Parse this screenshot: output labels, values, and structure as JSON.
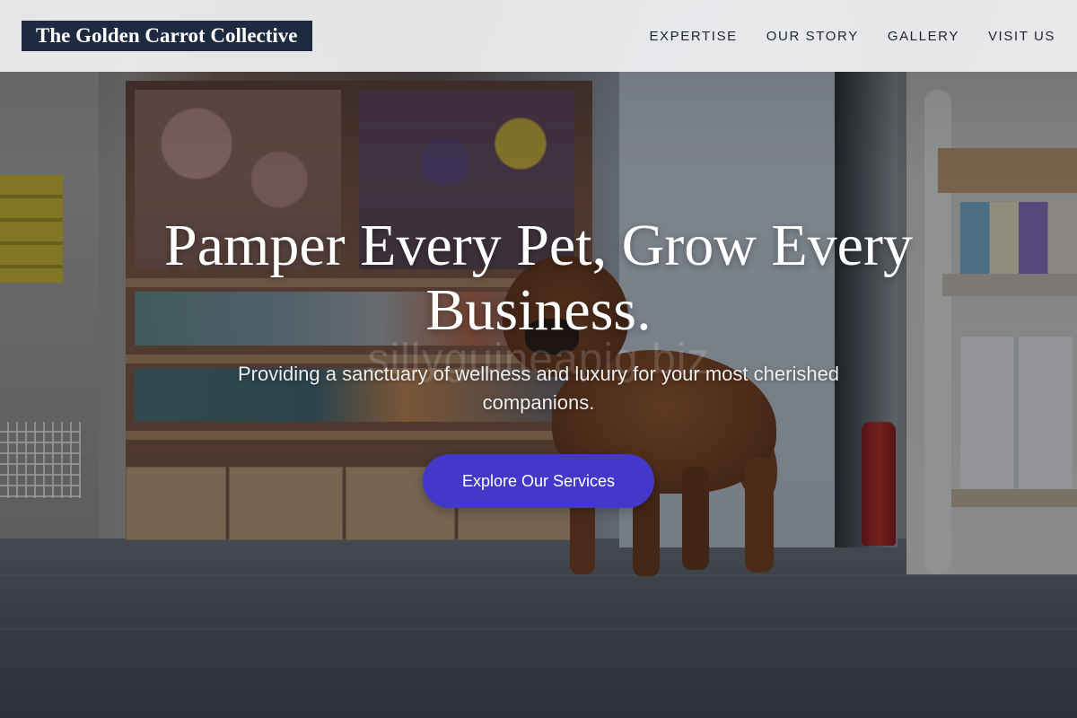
{
  "header": {
    "logo_text": "The Golden Carrot Collective",
    "nav": [
      {
        "label": "EXPERTISE"
      },
      {
        "label": "OUR STORY"
      },
      {
        "label": "GALLERY"
      },
      {
        "label": "VISIT US"
      }
    ]
  },
  "hero": {
    "headline": "Pamper Every Pet, Grow Every Business.",
    "subtitle": "Providing a sanctuary of wellness and luxury for your most cherished companions.",
    "cta_label": "Explore Our Services",
    "watermark": "sillyguineapig.biz"
  },
  "colors": {
    "header_background": "#f2f2f4",
    "logo_background": "#1e2a40",
    "cta_background": "#4338ca",
    "headline_text": "#ffffff"
  }
}
